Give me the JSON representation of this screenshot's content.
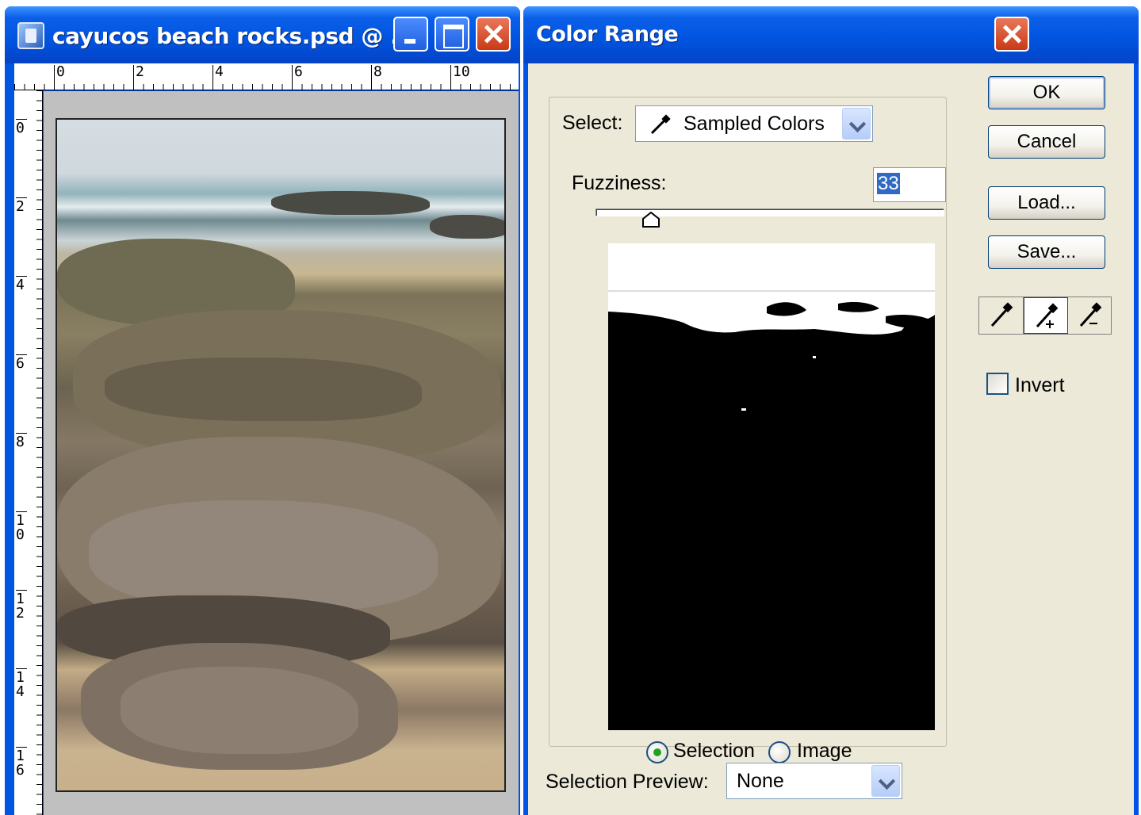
{
  "document_window": {
    "title": "cayucos beach rocks.psd @ ...",
    "h_ruler_ticks": [
      "0",
      "2",
      "4",
      "6",
      "8",
      "10"
    ],
    "v_ruler_ticks": [
      "0",
      "2",
      "4",
      "6",
      "8",
      "10",
      "12",
      "14",
      "16"
    ]
  },
  "dialog": {
    "title": "Color Range",
    "select_label": "Select:",
    "select_value": "Sampled Colors",
    "fuzziness_label": "Fuzziness:",
    "fuzziness_value": "33",
    "fuzziness_slider_percent": 16,
    "radio_selection": "Selection",
    "radio_image": "Image",
    "radio_selected": "Selection",
    "selection_preview_label": "Selection Preview:",
    "selection_preview_value": "None",
    "buttons": {
      "ok": "OK",
      "cancel": "Cancel",
      "load": "Load...",
      "save": "Save..."
    },
    "tools": [
      "eyedropper-icon",
      "eyedropper-plus-icon",
      "eyedropper-minus-icon"
    ],
    "invert_label": "Invert",
    "invert_checked": false
  },
  "colors": {
    "title_bar": "#0054e3",
    "dialog_face": "#ece9d8",
    "close_button": "#c93a17",
    "radio_dot": "#21a121",
    "text_selection": "#316ac5"
  }
}
